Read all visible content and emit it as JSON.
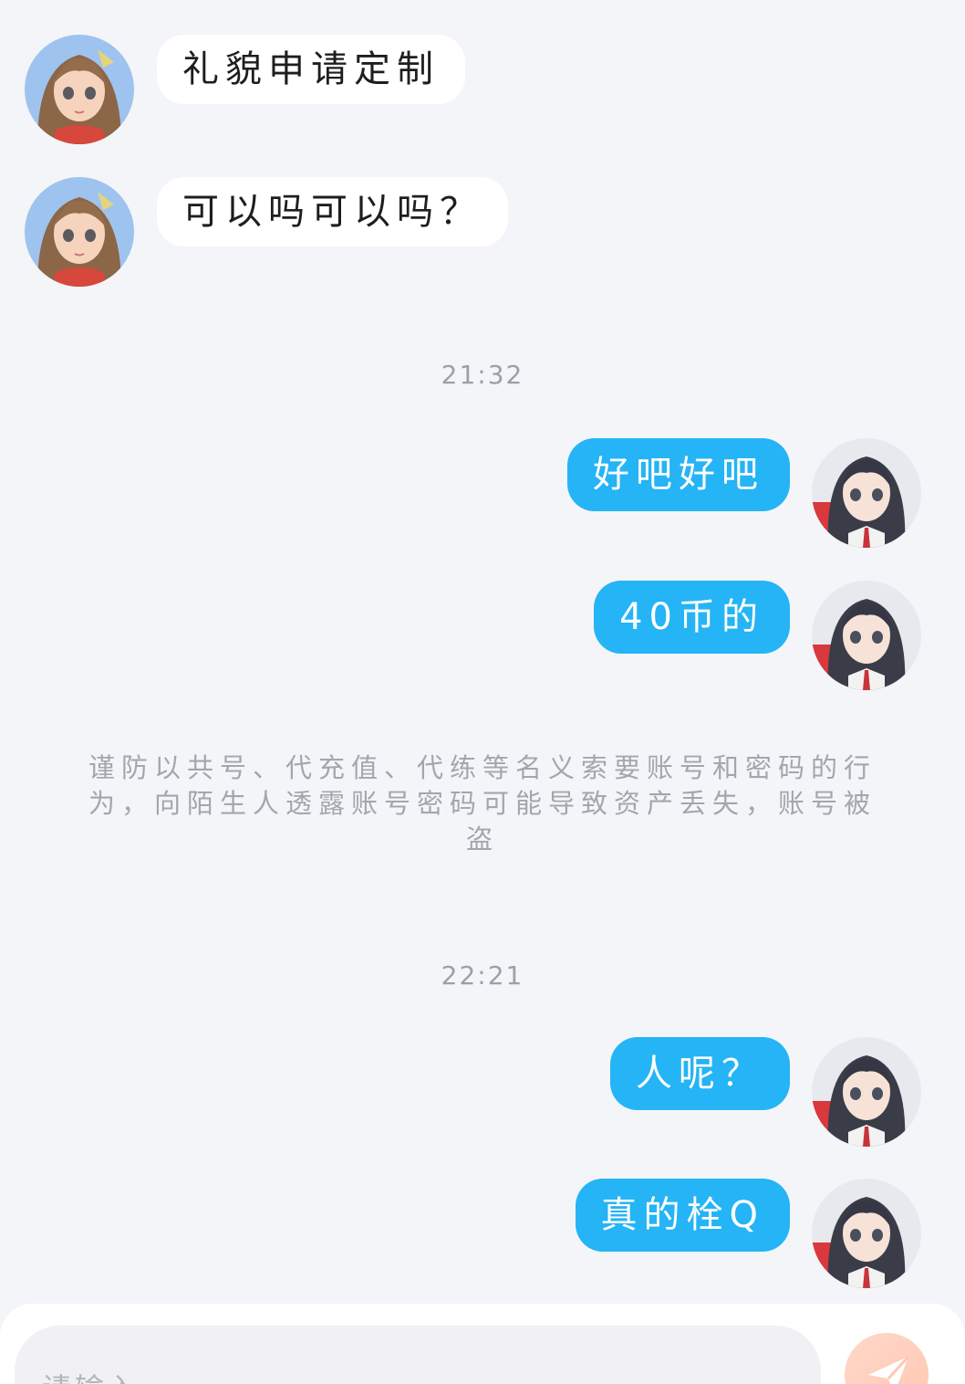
{
  "messages": [
    {
      "side": "left",
      "text": "礼貌申请定制"
    },
    {
      "side": "left",
      "text": "可以吗可以吗？"
    },
    {
      "side": "right",
      "text": "好吧好吧"
    },
    {
      "side": "right",
      "text": "40币的"
    },
    {
      "side": "right",
      "text": "人呢？"
    },
    {
      "side": "right",
      "text": "真的栓Q"
    }
  ],
  "timestamps": [
    "21:32",
    "22:21"
  ],
  "notice": "谨防以共号、代充值、代练等名义索要账号和密码的行为，向陌生人透露账号密码可能导致资产丢失，账号被盗",
  "input": {
    "placeholder": "请输入..."
  },
  "colors": {
    "background": "#f4f5f8",
    "outgoing_bubble": "#25b4f5",
    "incoming_bubble": "#ffffff",
    "send_button": "#ffc7b3"
  }
}
